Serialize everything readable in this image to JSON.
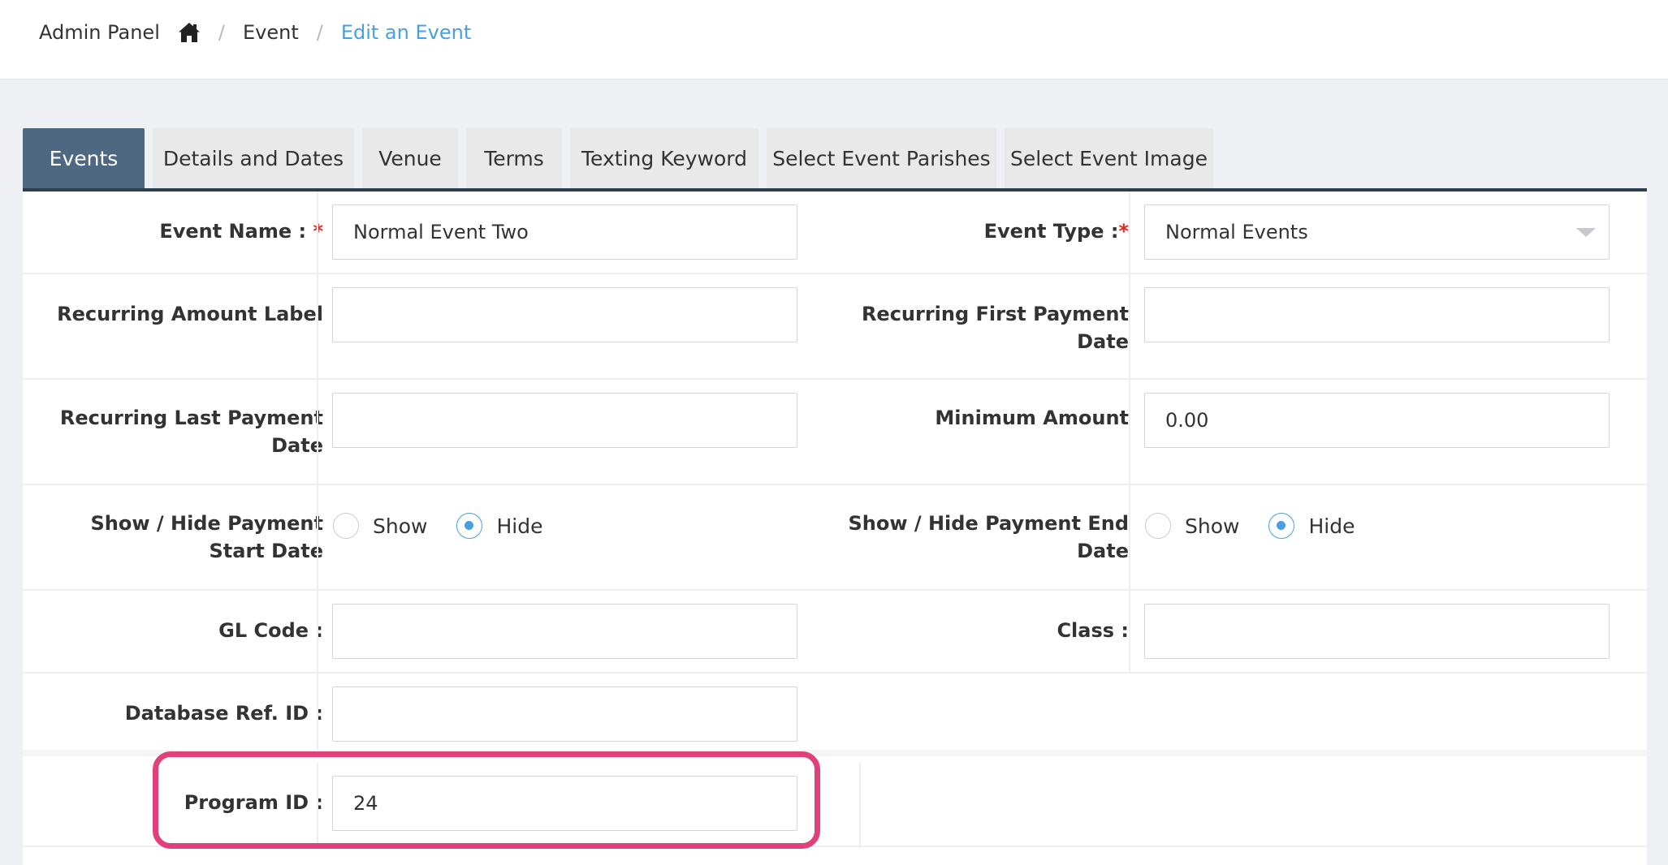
{
  "breadcrumb": {
    "root": "Admin Panel",
    "section": "Event",
    "current": "Edit an Event",
    "separator": "/"
  },
  "tabs": [
    {
      "label": "Events",
      "active": true
    },
    {
      "label": "Details and Dates",
      "active": false
    },
    {
      "label": "Venue",
      "active": false
    },
    {
      "label": "Terms",
      "active": false
    },
    {
      "label": "Texting Keyword",
      "active": false
    },
    {
      "label": "Select Event Parishes",
      "active": false
    },
    {
      "label": "Select Event Image",
      "active": false
    }
  ],
  "form": {
    "event_name": {
      "label": "Event Name :",
      "required_mark": "*",
      "value": "Normal Event Two"
    },
    "event_type": {
      "label": "Event Type :",
      "required_mark": "*",
      "value": "Normal Events"
    },
    "recurring_amount_label": {
      "label": "Recurring Amount Label",
      "value": ""
    },
    "recurring_first_payment_date": {
      "label_line1": "Recurring First Payment",
      "label_line2": "Date",
      "value": ""
    },
    "recurring_last_payment_date": {
      "label_line1": "Recurring Last Payment",
      "label_line2": "Date",
      "value": ""
    },
    "minimum_amount": {
      "label": "Minimum Amount",
      "value": "0.00"
    },
    "show_hide_payment_start": {
      "label_line1": "Show / Hide Payment",
      "label_line2": "Start Date",
      "options": [
        "Show",
        "Hide"
      ],
      "selected": "Hide"
    },
    "show_hide_payment_end": {
      "label_line1": "Show / Hide Payment End",
      "label_line2": "Date",
      "options": [
        "Show",
        "Hide"
      ],
      "selected": "Hide"
    },
    "gl_code": {
      "label": "GL Code :",
      "value": ""
    },
    "class": {
      "label": "Class :",
      "value": ""
    },
    "database_ref_id": {
      "label": "Database Ref. ID :",
      "value": ""
    },
    "program_id": {
      "label": "Program ID :",
      "value": "24"
    }
  },
  "colors": {
    "accent": "#4a9fe0",
    "active_tab": "#4f6882",
    "highlight": "#e0417b",
    "required": "#e0241f"
  },
  "icons": {
    "home": "home-icon"
  }
}
